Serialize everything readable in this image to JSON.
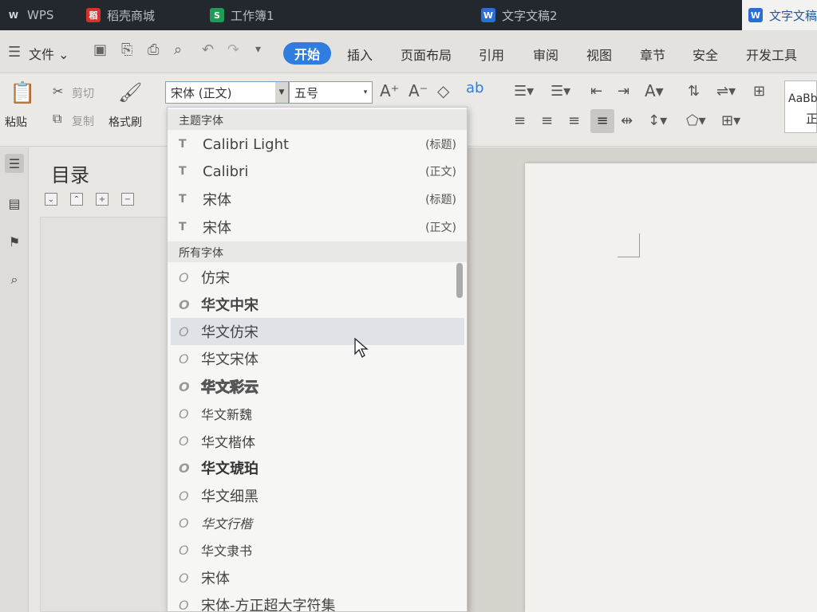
{
  "tabs": [
    {
      "label": "WPS",
      "icon": "wps-logo-icon"
    },
    {
      "label": "稻壳商城",
      "icon": "daoke-icon"
    },
    {
      "label": "工作簿1",
      "icon": "spreadsheet-icon"
    },
    {
      "label": "文字文稿2",
      "icon": "document-icon"
    },
    {
      "label": "文字文稿",
      "icon": "document-icon"
    }
  ],
  "menubar": {
    "file": "文件",
    "items": [
      "开始",
      "插入",
      "页面布局",
      "引用",
      "审阅",
      "视图",
      "章节",
      "安全",
      "开发工具"
    ],
    "active": "开始"
  },
  "ribbon": {
    "paste": "粘贴",
    "cut": "剪切",
    "copy": "复制",
    "format_painter": "格式刷",
    "font_name": "宋体 (正文)",
    "font_size": "五号",
    "style_preview": "AaBb",
    "style_label": "正"
  },
  "nav": {
    "title": "目录"
  },
  "dropdown": {
    "theme_header": "主题字体",
    "theme_fonts": [
      {
        "name": "Calibri Light",
        "note": "(标题)"
      },
      {
        "name": "Calibri",
        "note": "(正文)"
      },
      {
        "name": "宋体",
        "note": "(标题)"
      },
      {
        "name": "宋体",
        "note": "(正文)"
      }
    ],
    "all_header": "所有字体",
    "all_fonts": [
      "仿宋",
      "华文中宋",
      "华文仿宋",
      "华文宋体",
      "华文彩云",
      "华文新魏",
      "华文楷体",
      "华文琥珀",
      "华文细黑",
      "华文行楷",
      "华文隶书",
      "宋体",
      "宋体-方正超大字符集"
    ],
    "highlighted": "华文仿宋"
  }
}
